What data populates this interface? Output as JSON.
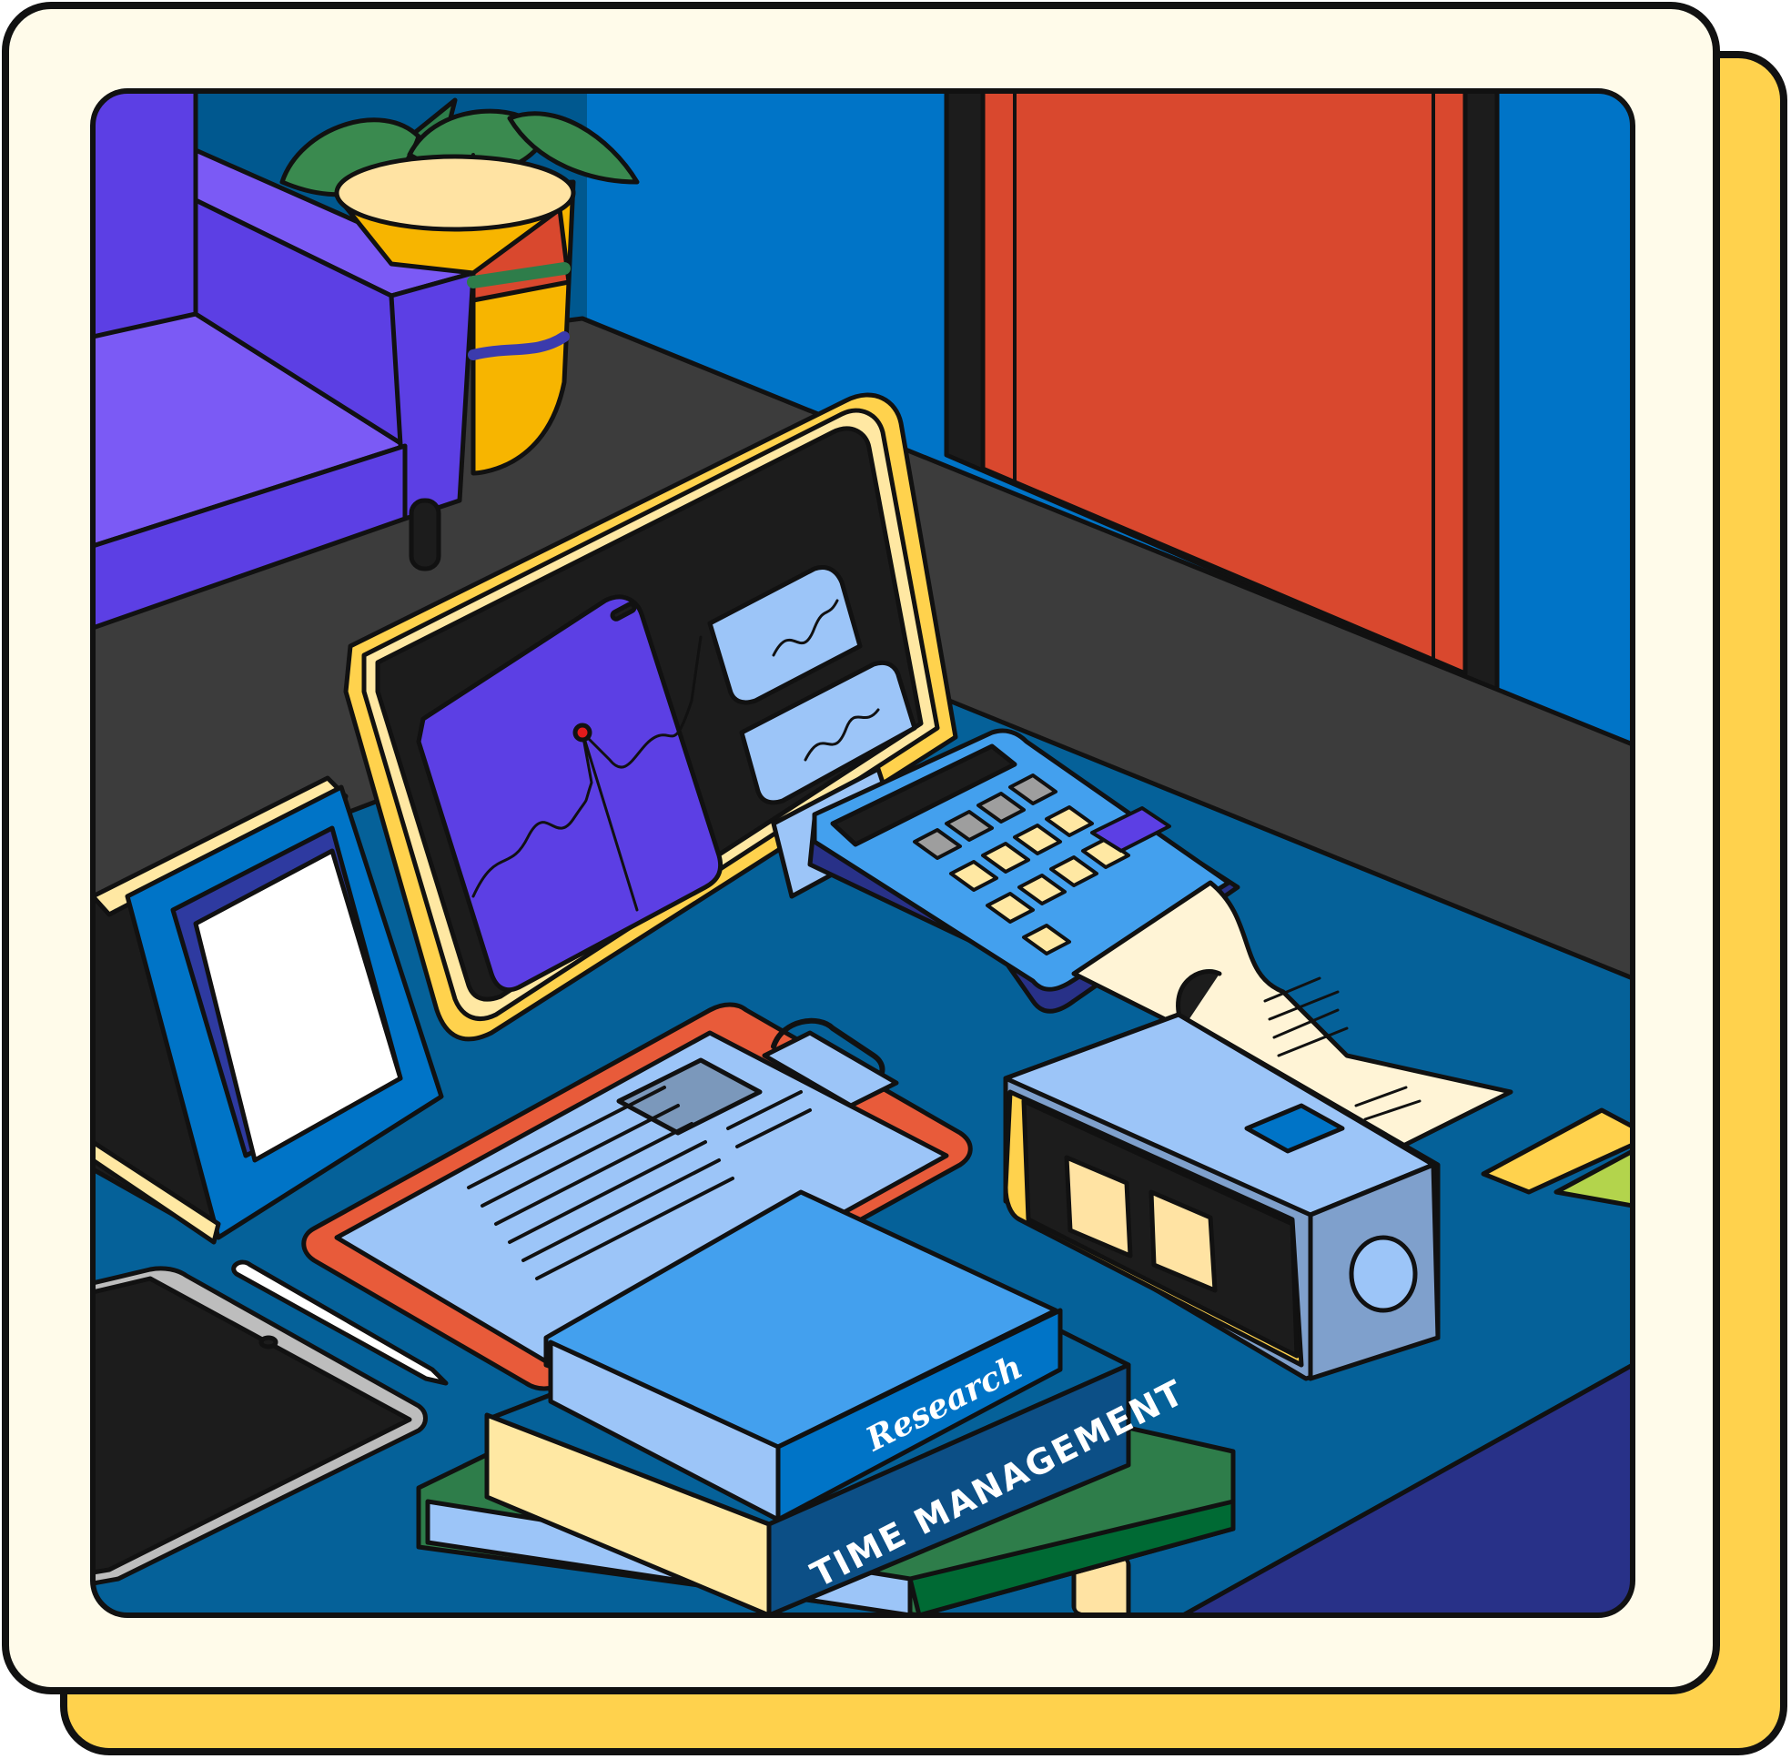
{
  "books": {
    "top_spine": "Research",
    "middle_spine": "TIME MANAGEMENT"
  },
  "colors": {
    "frame_cream": "#FFFBEA",
    "frame_shadow": "#FFD24D",
    "outline": "#111111",
    "wall_blue": "#0074C7",
    "door_red": "#D9482E",
    "desk_blue": "#056199",
    "desk_back": "#3C3C3C",
    "sofa_purple": "#5C3FE4",
    "pot_yellow": "#F7B500",
    "accent_light_blue": "#9CC5F8"
  },
  "icons": [
    "sofa-icon",
    "plant-icon",
    "monitor-icon",
    "calculator-icon",
    "receipt-icon",
    "clock-icon",
    "clipboard-icon",
    "book-icon",
    "tablet-icon",
    "pen-icon",
    "photo-frame-icon"
  ]
}
